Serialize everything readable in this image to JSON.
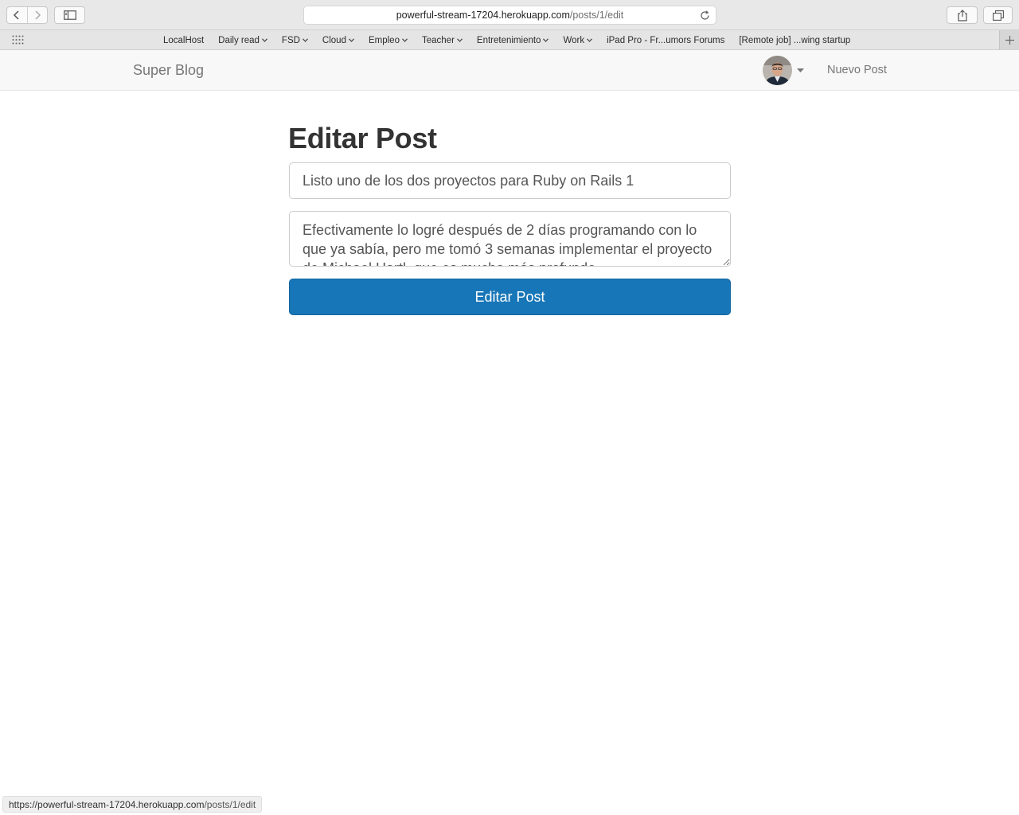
{
  "browser": {
    "url_domain": "powerful-stream-17204.herokuapp.com",
    "url_path": "/posts/1/edit",
    "bookmarks": [
      {
        "label": "LocalHost",
        "has_menu": false
      },
      {
        "label": "Daily read",
        "has_menu": true
      },
      {
        "label": "FSD",
        "has_menu": true
      },
      {
        "label": "Cloud",
        "has_menu": true
      },
      {
        "label": "Empleo",
        "has_menu": true
      },
      {
        "label": "Teacher",
        "has_menu": true
      },
      {
        "label": "Entretenimiento",
        "has_menu": true
      },
      {
        "label": "Work",
        "has_menu": true
      },
      {
        "label": "iPad Pro - Fr...umors Forums",
        "has_menu": false
      },
      {
        "label": "[Remote job] ...wing startup",
        "has_menu": false
      }
    ],
    "status_domain": "https://powerful-stream-17204.herokuapp.com",
    "status_path": "/posts/1/edit"
  },
  "navbar": {
    "brand": "Super Blog",
    "new_post": "Nuevo Post"
  },
  "form": {
    "heading": "Editar Post",
    "title_value": "Listo uno de los dos proyectos para Ruby on Rails 1",
    "body_value": "Efectivamente lo logré después de 2 días programando con lo que ya sabía, pero me tomó 3 semanas implementar el proyecto de Michael Hartl, que es mucho más profundo.",
    "submit_label": "Editar Post"
  },
  "colors": {
    "primary_button": "#1776b7",
    "navbar_bg": "#f8f8f8"
  }
}
